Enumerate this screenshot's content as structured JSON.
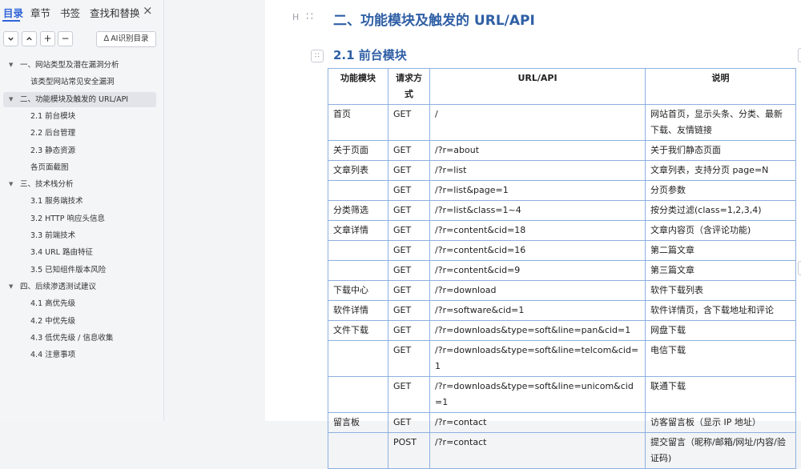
{
  "nav": {
    "tabs": [
      {
        "label": "目录",
        "active": true
      },
      {
        "label": "章节",
        "active": false
      },
      {
        "label": "书签",
        "active": false
      },
      {
        "label": "查找和替换",
        "active": false
      }
    ],
    "close_icon": "×",
    "controls": {
      "collapse": "⌄",
      "expand": "⌃",
      "add": "+",
      "remove": "−"
    },
    "ai_button": {
      "icon": "ai-scan-icon",
      "label": "AI识别目录"
    },
    "toc": [
      {
        "level": 1,
        "expanded": true,
        "label": "一、网站类型及潜在漏洞分析"
      },
      {
        "level": 2,
        "label": "该类型网站常见安全漏洞"
      },
      {
        "level": 1,
        "expanded": true,
        "selected": true,
        "label": "二、功能模块及触发的 URL/API"
      },
      {
        "level": 2,
        "label": "2.1 前台模块"
      },
      {
        "level": 2,
        "label": "2.2 后台管理"
      },
      {
        "level": 2,
        "label": "2.3 静态资源"
      },
      {
        "level": 2,
        "label": "各页面截图"
      },
      {
        "level": 1,
        "expanded": true,
        "label": "三、技术栈分析"
      },
      {
        "level": 2,
        "label": "3.1 服务端技术"
      },
      {
        "level": 2,
        "label": "3.2 HTTP 响应头信息"
      },
      {
        "level": 2,
        "label": "3.3 前端技术"
      },
      {
        "level": 2,
        "label": "3.4 URL 路由特征"
      },
      {
        "level": 2,
        "label": "3.5 已知组件版本风险"
      },
      {
        "level": 1,
        "expanded": true,
        "label": "四、后续渗透测试建议"
      },
      {
        "level": 2,
        "label": "4.1 高优先级"
      },
      {
        "level": 2,
        "label": "4.2 中优先级"
      },
      {
        "level": 2,
        "label": "4.3 低优先级 / 信息收集"
      },
      {
        "level": 2,
        "label": "4.4 注意事项"
      }
    ]
  },
  "doc": {
    "heading_marker": "H",
    "section_title": "二、功能模块及触发的 URL/API",
    "subsection_title": "2.1 前台模块",
    "table": {
      "headers": [
        "功能模块",
        "请求方式",
        "URL/API",
        "说明"
      ],
      "rows": [
        {
          "module": "首页",
          "method": "GET",
          "url": "/",
          "desc": "网站首页，显示头条、分类、最新下载、友情链接"
        },
        {
          "module": "关于页面",
          "method": "GET",
          "url": "/?r=about",
          "desc": "关于我们静态页面"
        },
        {
          "module": "文章列表",
          "method": "GET",
          "url": "/?r=list",
          "desc": "文章列表，支持分页 page=N"
        },
        {
          "module": "",
          "method": "GET",
          "url": "/?r=list&page=1",
          "desc": "分页参数"
        },
        {
          "module": "分类筛选",
          "method": "GET",
          "url": "/?r=list&class=1~4",
          "desc": "按分类过滤(class=1,2,3,4)"
        },
        {
          "module": "文章详情",
          "method": "GET",
          "url": "/?r=content&cid=18",
          "desc": "文章内容页（含评论功能)"
        },
        {
          "module": "",
          "method": "GET",
          "url": "/?r=content&cid=16",
          "desc": "第二篇文章"
        },
        {
          "module": "",
          "method": "GET",
          "url": "/?r=content&cid=9",
          "desc": "第三篇文章"
        },
        {
          "module": "下载中心",
          "method": "GET",
          "url": "/?r=download",
          "desc": "软件下载列表"
        },
        {
          "module": "软件详情",
          "method": "GET",
          "url": "/?r=software&cid=1",
          "desc": "软件详情页，含下载地址和评论"
        },
        {
          "module": "文件下载",
          "method": "GET",
          "url": "/?r=downloads&type=soft&line=pan&cid=1",
          "desc": "网盘下载"
        },
        {
          "module": "",
          "method": "GET",
          "url": "/?r=downloads&type=soft&line=telcom&cid=1",
          "desc": "电信下载"
        },
        {
          "module": "",
          "method": "GET",
          "url": "/?r=downloads&type=soft&line=unicom&cid=1",
          "desc": "联通下载"
        },
        {
          "module": "留言板",
          "method": "GET",
          "url": "/?r=contact",
          "desc": "访客留言板（显示 IP 地址）"
        },
        {
          "module": "",
          "method": "POST",
          "url": "/?r=contact",
          "desc": "提交留言（昵称/邮箱/网址/内容/验证码)"
        }
      ]
    }
  },
  "colors": {
    "accent": "#2f64d8",
    "heading": "#2f5fa5",
    "table_border": "#8db0e0",
    "selected_bg": "#e2e4e9"
  }
}
